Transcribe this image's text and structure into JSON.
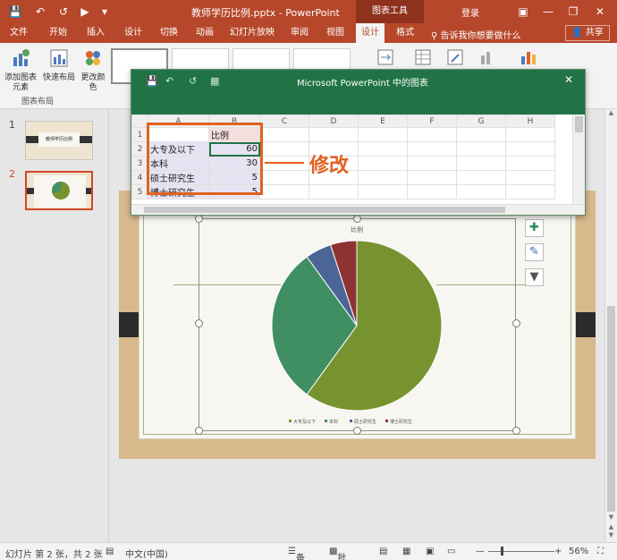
{
  "app": {
    "document_title": "教师学历比例.pptx - PowerPoint",
    "context_tab_group": "图表工具",
    "login": "登录",
    "share": "共享",
    "tell_me": "告诉我你想要做什么"
  },
  "tabs": [
    "文件",
    "开始",
    "插入",
    "设计",
    "切换",
    "动画",
    "幻灯片放映",
    "审阅",
    "视图",
    "设计",
    "格式"
  ],
  "active_tab_index": 9,
  "ribbon": {
    "add_chart_element": "添加图表元素",
    "quick_layout": "快速布局",
    "change_colors": "更改颜色",
    "group_label": "图表布局"
  },
  "slides": [
    {
      "number": "1",
      "title": "教师学历比例"
    },
    {
      "number": "2"
    }
  ],
  "chart_window": {
    "title": "Microsoft PowerPoint 中的图表"
  },
  "spreadsheet": {
    "columns": [
      "A",
      "B",
      "C",
      "D",
      "E",
      "F",
      "G",
      "H"
    ],
    "rows": [
      {
        "row": "1",
        "a": "",
        "b": "比例"
      },
      {
        "row": "2",
        "a": "大专及以下",
        "b": "60"
      },
      {
        "row": "3",
        "a": "本科",
        "b": "30"
      },
      {
        "row": "4",
        "a": "硕士研究生",
        "b": "5"
      },
      {
        "row": "5",
        "a": "博士研究生",
        "b": "5"
      }
    ]
  },
  "annotation": "修改",
  "chart_data": {
    "type": "pie",
    "title": "比例",
    "categories": [
      "大专及以下",
      "本科",
      "硕士研究生",
      "博士研究生"
    ],
    "values": [
      60,
      30,
      5,
      5
    ],
    "colors": [
      "#77932f",
      "#3f8f63",
      "#4a6596",
      "#8e3333"
    ],
    "legend_position": "bottom"
  },
  "status": {
    "slide_info": "幻灯片 第 2 张，共 2 张",
    "language": "中文(中国)",
    "notes": "备注",
    "comments": "批注",
    "zoom": "56%"
  }
}
